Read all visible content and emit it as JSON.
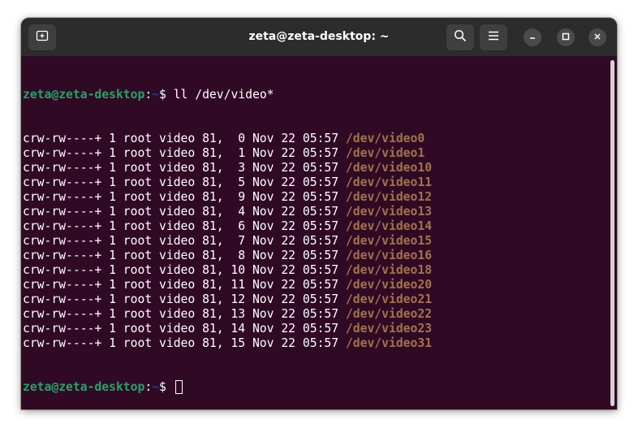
{
  "window": {
    "title": "zeta@zeta-desktop: ~"
  },
  "titlebar": {
    "buttons": [
      {
        "name": "new-tab",
        "icon": "new-tab-icon"
      },
      {
        "name": "search",
        "icon": "search-icon"
      },
      {
        "name": "menu",
        "icon": "hamburger-menu-icon"
      },
      {
        "name": "minimize",
        "icon": "minimize-icon"
      },
      {
        "name": "maximize",
        "icon": "maximize-icon"
      },
      {
        "name": "close",
        "icon": "close-icon"
      }
    ]
  },
  "terminal": {
    "prompt": {
      "user_host": "zeta@zeta-desktop",
      "colon": ":",
      "path": "~",
      "symbol": "$ "
    },
    "command": "ll /dev/video*",
    "output": [
      {
        "text": "crw-rw----+ 1 root video 81,  0 Nov 22 05:57 ",
        "file": "/dev/video0"
      },
      {
        "text": "crw-rw----+ 1 root video 81,  1 Nov 22 05:57 ",
        "file": "/dev/video1"
      },
      {
        "text": "crw-rw----+ 1 root video 81,  3 Nov 22 05:57 ",
        "file": "/dev/video10"
      },
      {
        "text": "crw-rw----+ 1 root video 81,  5 Nov 22 05:57 ",
        "file": "/dev/video11"
      },
      {
        "text": "crw-rw----+ 1 root video 81,  9 Nov 22 05:57 ",
        "file": "/dev/video12"
      },
      {
        "text": "crw-rw----+ 1 root video 81,  4 Nov 22 05:57 ",
        "file": "/dev/video13"
      },
      {
        "text": "crw-rw----+ 1 root video 81,  6 Nov 22 05:57 ",
        "file": "/dev/video14"
      },
      {
        "text": "crw-rw----+ 1 root video 81,  7 Nov 22 05:57 ",
        "file": "/dev/video15"
      },
      {
        "text": "crw-rw----+ 1 root video 81,  8 Nov 22 05:57 ",
        "file": "/dev/video16"
      },
      {
        "text": "crw-rw----+ 1 root video 81, 10 Nov 22 05:57 ",
        "file": "/dev/video18"
      },
      {
        "text": "crw-rw----+ 1 root video 81, 11 Nov 22 05:57 ",
        "file": "/dev/video20"
      },
      {
        "text": "crw-rw----+ 1 root video 81, 12 Nov 22 05:57 ",
        "file": "/dev/video21"
      },
      {
        "text": "crw-rw----+ 1 root video 81, 13 Nov 22 05:57 ",
        "file": "/dev/video22"
      },
      {
        "text": "crw-rw----+ 1 root video 81, 14 Nov 22 05:57 ",
        "file": "/dev/video23"
      },
      {
        "text": "crw-rw----+ 1 root video 81, 15 Nov 22 05:57 ",
        "file": "/dev/video31"
      }
    ]
  },
  "colors": {
    "terminal_bg": "#300a24",
    "titlebar_bg": "#2c2c2c",
    "prompt_user": "#26a269",
    "prompt_path": "#12488b",
    "device_file": "#a2734c",
    "text": "#ffffff"
  }
}
